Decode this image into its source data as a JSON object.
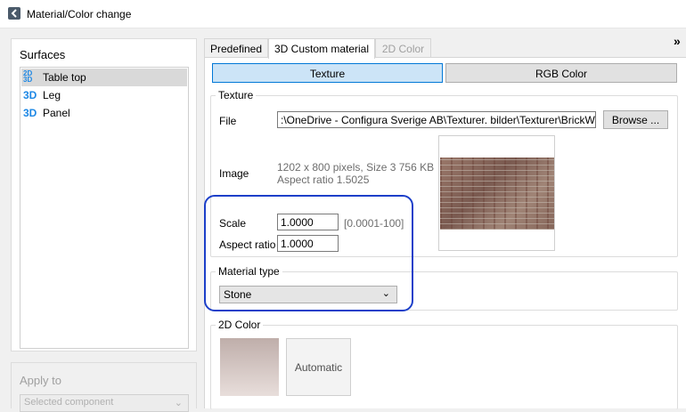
{
  "window": {
    "title": "Material/Color change"
  },
  "surfaces": {
    "title": "Surfaces",
    "items": [
      {
        "badge": "2D\n3D",
        "label": "Table top",
        "selected": true
      },
      {
        "badge": "3D",
        "label": "Leg",
        "selected": false
      },
      {
        "badge": "3D",
        "label": "Panel",
        "selected": false
      }
    ]
  },
  "apply_to": {
    "title": "Apply to",
    "placeholder": "Selected component"
  },
  "tabs": [
    {
      "label": "Predefined"
    },
    {
      "label": "3D Custom material"
    },
    {
      "label": "2D Color"
    }
  ],
  "mode_buttons": {
    "texture": "Texture",
    "rgb": "RGB Color"
  },
  "texture": {
    "group_title": "Texture",
    "file_label": "File",
    "file_value": ":\\OneDrive - Configura Sverige AB\\Texturer. bilder\\Texturer\\BrickWall.jpg",
    "browse_label": "Browse ...",
    "image_label": "Image",
    "image_info_1": "1202 x 800 pixels, Size 3 756 KB",
    "image_info_2": "Aspect ratio 1.5025",
    "scale_label": "Scale",
    "scale_value": "1.0000",
    "scale_range": "[0.0001-100]",
    "aspect_label": "Aspect ratio",
    "aspect_value": "1.0000"
  },
  "material_type": {
    "group_title": "Material type",
    "value": "Stone"
  },
  "color2d": {
    "group_title": "2D Color",
    "auto_label": "Automatic"
  },
  "colors": {
    "highlight": "#1c3fc9",
    "accent_blue": "#1e88e5",
    "selected_button": "#cce4f7"
  }
}
